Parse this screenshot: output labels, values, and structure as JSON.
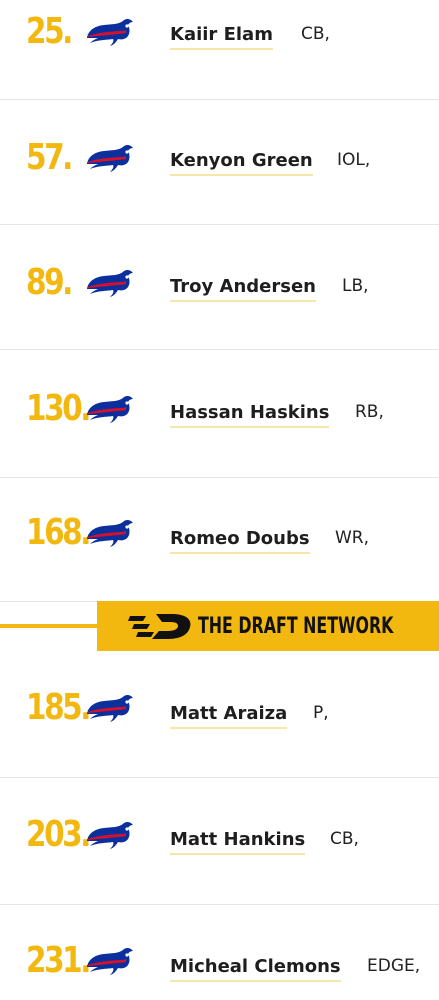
{
  "picks": [
    {
      "number": "25.",
      "name": "Kaiir Elam",
      "position": "CB,"
    },
    {
      "number": "57.",
      "name": "Kenyon Green",
      "position": "IOL,"
    },
    {
      "number": "89.",
      "name": "Troy Andersen",
      "position": "LB,"
    },
    {
      "number": "130.",
      "name": "Hassan Haskins",
      "position": "RB,"
    },
    {
      "number": "168.",
      "name": "Romeo Doubs",
      "position": "WR,"
    },
    {
      "number": "185.",
      "name": "Matt Araiza",
      "position": "P,"
    },
    {
      "number": "203.",
      "name": "Matt Hankins",
      "position": "CB,"
    },
    {
      "number": "231.",
      "name": "Micheal Clemons",
      "position": "EDGE,"
    }
  ],
  "team_logo_icon": "buffalo-bills-logo-icon",
  "brand": {
    "name": "THE DRAFT NETWORK",
    "logo_icon": "draft-network-logo-icon"
  },
  "colors": {
    "accent_gold": "#f2b80f",
    "bills_blue": "#0c2f9e",
    "bills_red": "#d4112b"
  }
}
